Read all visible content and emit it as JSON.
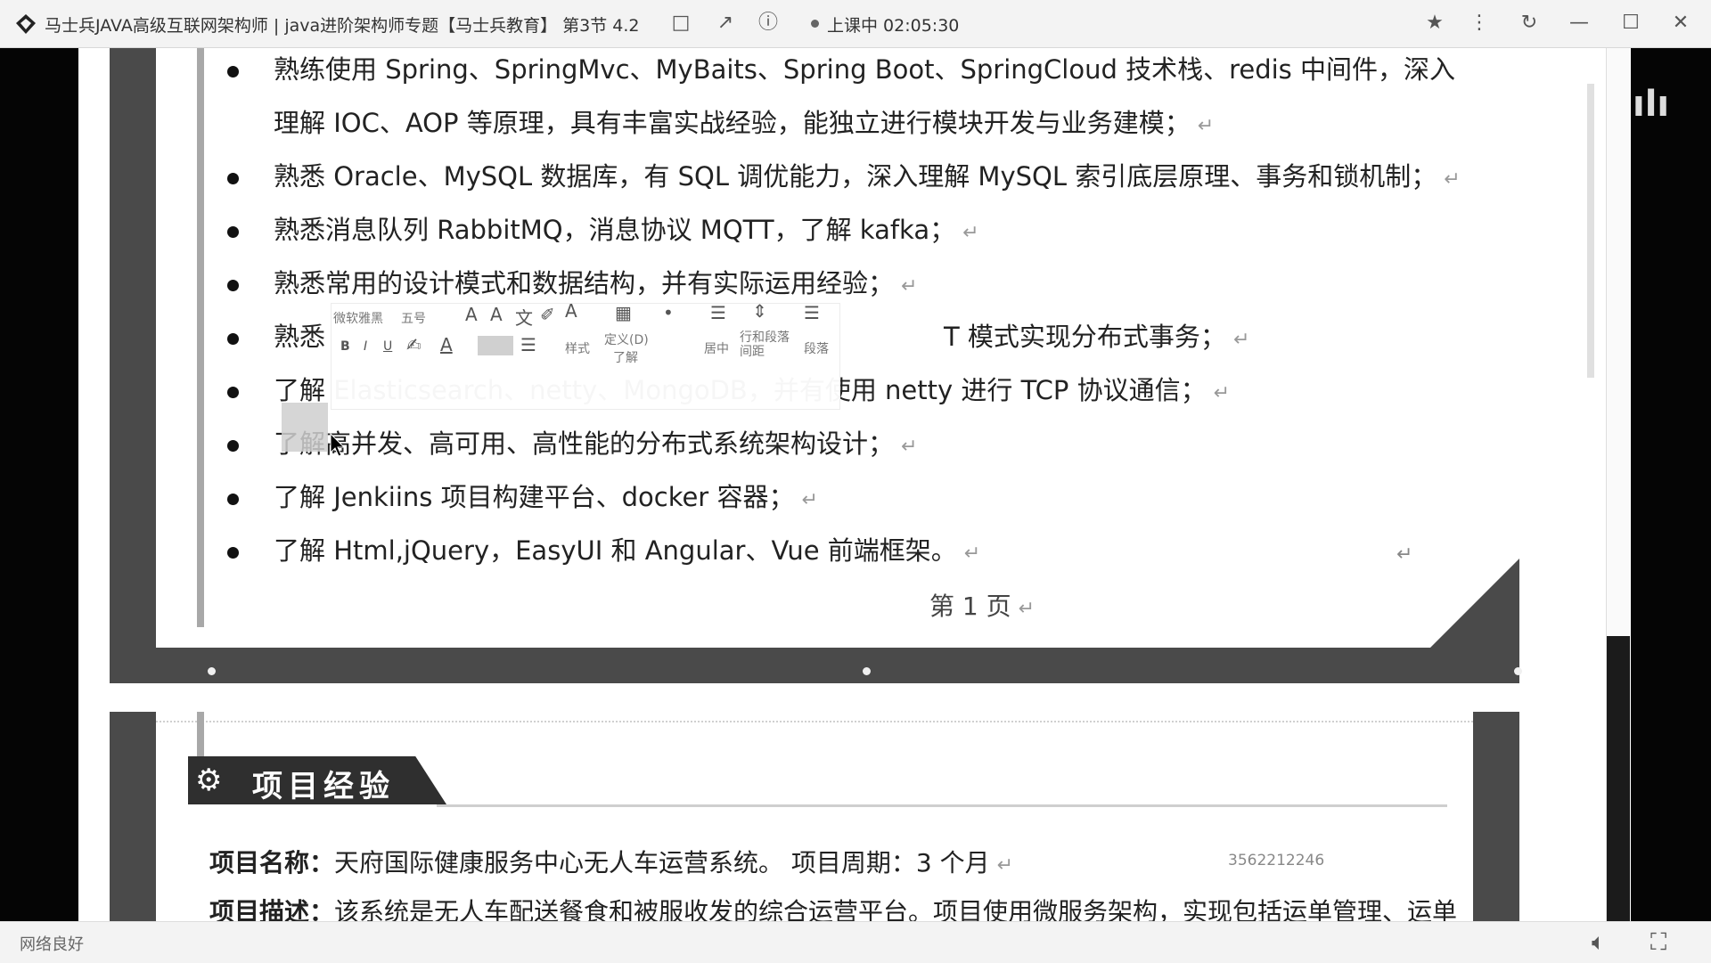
{
  "titlebar": {
    "title": "马士兵JAVA高级互联网架构师 | java进阶架构师专题【马士兵教育】 第3节 4.2",
    "clock": "上课中 02:05:30"
  },
  "icons": {
    "app_logo": "diamond-logo-icon",
    "pin": "pin-icon",
    "more": "more-icon",
    "refresh": "refresh-icon",
    "minimize": "minimize-icon",
    "maximize": "maximize-icon",
    "close": "close-icon"
  },
  "document": {
    "skills": [
      "熟练使用 Spring、SpringMvc、MyBaits、Spring Boot、SpringCloud 技术栈、redis 中间件，深入",
      "理解 IOC、AOP 等原理，具有丰富实战经验，能独立进行模块开发与业务建模；",
      "熟悉 Oracle、MySQL 数据库，有 SQL 调优能力，深入理解 MySQL 索引底层原理、事务和锁机制；",
      "熟悉消息队列 RabbitMQ，消息协议 MQTT，了解 kafka；",
      "熟悉常用的设计模式和数据结构，并有实际运用经验；",
      "熟悉",
      "T 模式实现分布式事务；",
      "了解 Elasticsearch、netty、MongoDB，并有使用 netty 进行 TCP 协议通信；",
      "了解高并发、高可用、高性能的分布式系统架构设计；",
      "了解 Jenkiins 项目构建平台、docker 容器；",
      "了解 Html,jQuery，EasyUI 和 Angular、Vue 前端框架。"
    ],
    "page_number": "第 1 页",
    "mini_toolbar": {
      "font_name": "微软雅黑",
      "font_size": "五号",
      "bold": "B",
      "italic": "I",
      "underline": "U",
      "style_label": "样式",
      "define_label": "定义(D)",
      "understand_label": "了解",
      "center_label": "居中",
      "line_spacing_label": "行和段落间距",
      "paragraph_label": "段落"
    },
    "section_title": "项目经验",
    "project_name_label": "项目名称：",
    "project_name_value": "天府国际健康服务中心无人车运营系统。  项目周期：3 个月",
    "project_desc_label": "项目描述：",
    "project_desc_value": "该系统是无人车配送餐食和被服收发的综合运营平台。项目使用微服务架构，实现包括运单管理、运单",
    "watermark_id": "3562212246"
  },
  "statusbar": {
    "network": "网络良好"
  }
}
